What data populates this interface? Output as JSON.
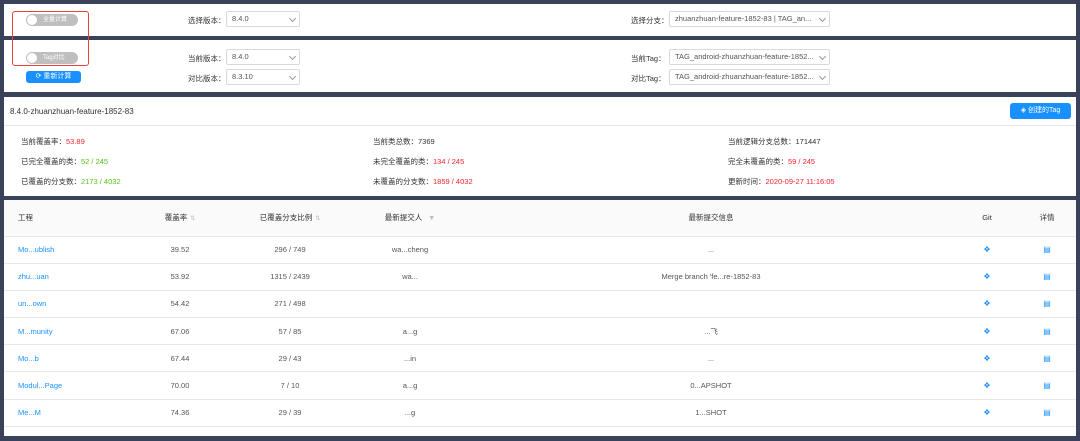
{
  "top_panel": {
    "toggle_full_calc": "全量计算",
    "select_version_label": "选择版本：",
    "select_version_value": "8.4.0",
    "select_branch_label": "选择分支：",
    "select_branch_value": "zhuanzhuan-feature-1852-83 | TAG_an..."
  },
  "compare_panel": {
    "toggle_tag_compare": "Tag对比",
    "recalc_button": "重新计算",
    "current_version_label": "当前版本：",
    "current_version_value": "8.4.0",
    "compare_version_label": "对比版本：",
    "compare_version_value": "8.3.10",
    "current_tag_label": "当前Tag：",
    "current_tag_value": "TAG_android-zhuanzhuan-feature-1852...",
    "compare_tag_label": "对比Tag：",
    "compare_tag_value": "TAG_android-zhuanzhuan-feature-1852..."
  },
  "summary": {
    "title": "8.4.0-zhuanzhuan-feature-1852-83",
    "create_tag_button": "创建的Tag",
    "coverage_label": "当前覆盖率：",
    "coverage_value": "53.89",
    "total_classes_label": "当前类总数：",
    "total_classes_value": "7369",
    "total_branches_label": "当前逻辑分支总数：",
    "total_branches_value": "171447",
    "fully_covered_label": "已完全覆盖的类：",
    "fully_covered_value": "52 / 245",
    "not_fully_covered_label": "未完全覆盖的类：",
    "not_fully_covered_value": "134 / 245",
    "fully_uncovered_label": "完全未覆盖的类：",
    "fully_uncovered_value": "59 / 245",
    "covered_branches_label": "已覆盖的分支数：",
    "covered_branches_value": "2173 / 4032",
    "uncovered_branches_label": "未覆盖的分支数：",
    "uncovered_branches_value": "1859 / 4032",
    "updated_label": "更新时间：",
    "updated_value": "2020-09-27 11:16:05"
  },
  "table": {
    "headers": {
      "project": "工程",
      "coverage": "覆盖率",
      "branch_ratio": "已覆盖分支比例",
      "committer": "最新提交人",
      "commit_msg": "最新提交信息",
      "git": "Git",
      "detail": "详情"
    },
    "rows": [
      {
        "project": "Mo...ublish",
        "coverage": "39.52",
        "ratio": "296 / 749",
        "committer": "wa...cheng",
        "msg": "..."
      },
      {
        "project": "zhu...uan",
        "coverage": "53.92",
        "ratio": "1315 / 2439",
        "committer": "wa...",
        "msg": "Merge branch 'fe...re-1852-83"
      },
      {
        "project": "un...own",
        "coverage": "54.42",
        "ratio": "271 / 498",
        "committer": "",
        "msg": ""
      },
      {
        "project": "M...munity",
        "coverage": "67.06",
        "ratio": "57 / 85",
        "committer": "a...g",
        "msg": "...飞"
      },
      {
        "project": "Mo...b",
        "coverage": "67.44",
        "ratio": "29 / 43",
        "committer": "...in",
        "msg": "..."
      },
      {
        "project": "Modul...Page",
        "coverage": "70.00",
        "ratio": "7 / 10",
        "committer": "a...g",
        "msg": "0...APSHOT"
      },
      {
        "project": "Me...M",
        "coverage": "74.36",
        "ratio": "29 / 39",
        "committer": "...g",
        "msg": "1...SHOT"
      }
    ]
  }
}
